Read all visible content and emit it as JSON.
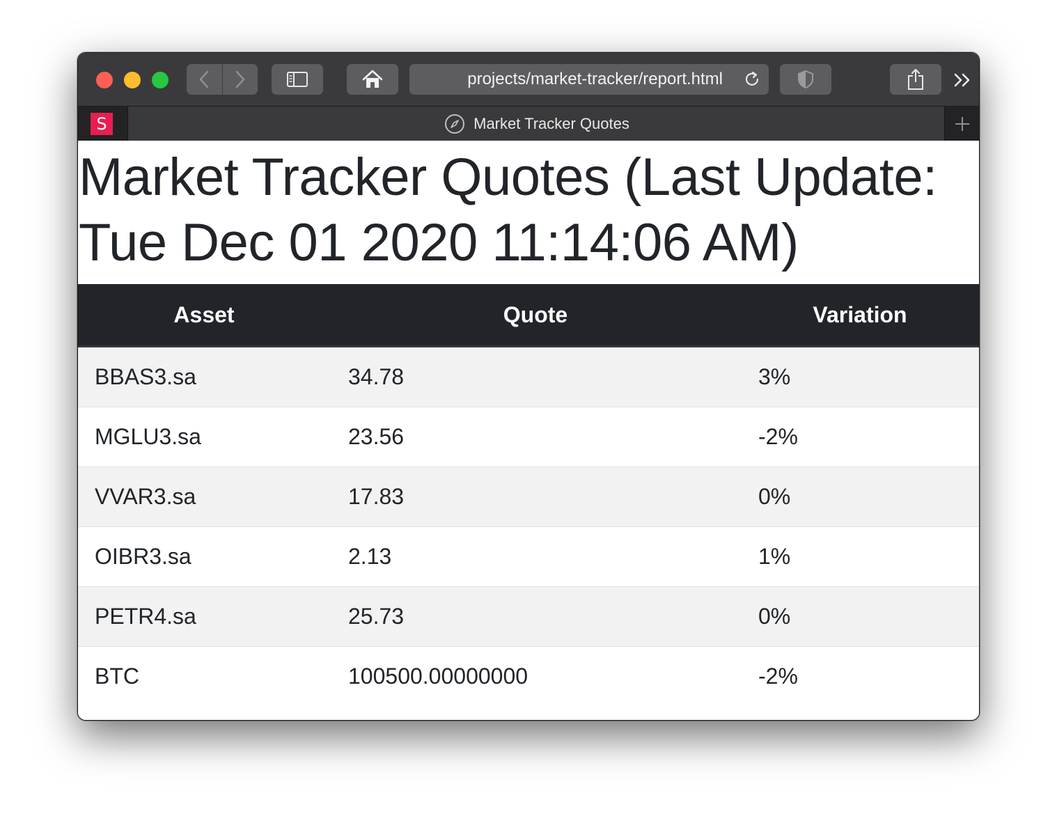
{
  "browser": {
    "url": "projects/market-tracker/report.html",
    "tabs": {
      "pinned_favicon_letter": "S",
      "active_title": "Market Tracker Quotes"
    },
    "colors": {
      "close": "#ff5f57",
      "minimize": "#febc2e",
      "maximize": "#28c840",
      "pinned_favicon": "#e91e50"
    }
  },
  "page": {
    "title": "Market Tracker Quotes (Last Update: Tue Dec 01 2020 11:14:06 AM)",
    "table": {
      "headers": [
        "Asset",
        "Quote",
        "Variation"
      ],
      "rows": [
        {
          "asset": "BBAS3.sa",
          "quote": "34.78",
          "variation": "3%"
        },
        {
          "asset": "MGLU3.sa",
          "quote": "23.56",
          "variation": "-2%"
        },
        {
          "asset": "VVAR3.sa",
          "quote": "17.83",
          "variation": "0%"
        },
        {
          "asset": "OIBR3.sa",
          "quote": "2.13",
          "variation": "1%"
        },
        {
          "asset": "PETR4.sa",
          "quote": "25.73",
          "variation": "0%"
        },
        {
          "asset": "BTC",
          "quote": "100500.00000000",
          "variation": "-2%"
        }
      ]
    }
  }
}
